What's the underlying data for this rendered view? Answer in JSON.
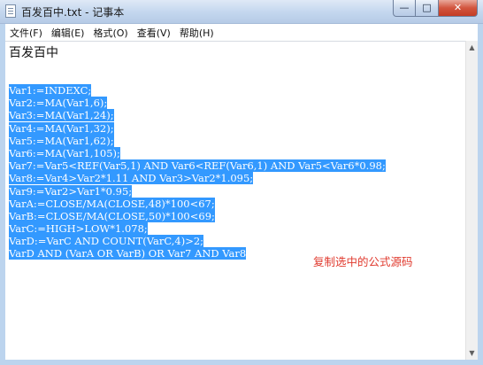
{
  "window": {
    "title": "百发百中.txt - 记事本",
    "icon": "notepad-icon",
    "buttons": {
      "minimize": "—",
      "maximize": "□",
      "close": "✕"
    }
  },
  "menu": {
    "items": [
      {
        "label": "文件(F)"
      },
      {
        "label": "编辑(E)"
      },
      {
        "label": "格式(O)"
      },
      {
        "label": "查看(V)"
      },
      {
        "label": "帮助(H)"
      }
    ]
  },
  "editor": {
    "heading": "百发百中",
    "selection_color": "#3399ff",
    "code_lines": [
      "Var1:=INDEXC;",
      "Var2:=MA(Var1,6);",
      "Var3:=MA(Var1,24);",
      "Var4:=MA(Var1,32);",
      "Var5:=MA(Var1,62);",
      "Var6:=MA(Var1,105);",
      "Var7:=Var5<REF(Var5,1) AND Var6<REF(Var6,1) AND Var5<Var6*0.98;",
      "Var8:=Var4>Var2*1.11 AND Var3>Var2*1.095;",
      "Var9:=Var2>Var1*0.95;",
      "VarA:=CLOSE/MA(CLOSE,48)*100<67;",
      "VarB:=CLOSE/MA(CLOSE,50)*100<69;",
      "VarC:=HIGH>LOW*1.078;",
      "VarD:=VarC AND COUNT(VarC,4)>2;",
      "VarD AND (VarA OR VarB)  OR Var7 AND Var8"
    ]
  },
  "annotation": {
    "text": "复制选中的公式源码",
    "color": "#e03a2e"
  },
  "scrollbar": {
    "up_icon": "scroll-up-arrow-icon",
    "down_icon": "scroll-down-arrow-icon",
    "up_glyph": "▲",
    "down_glyph": "▼"
  }
}
